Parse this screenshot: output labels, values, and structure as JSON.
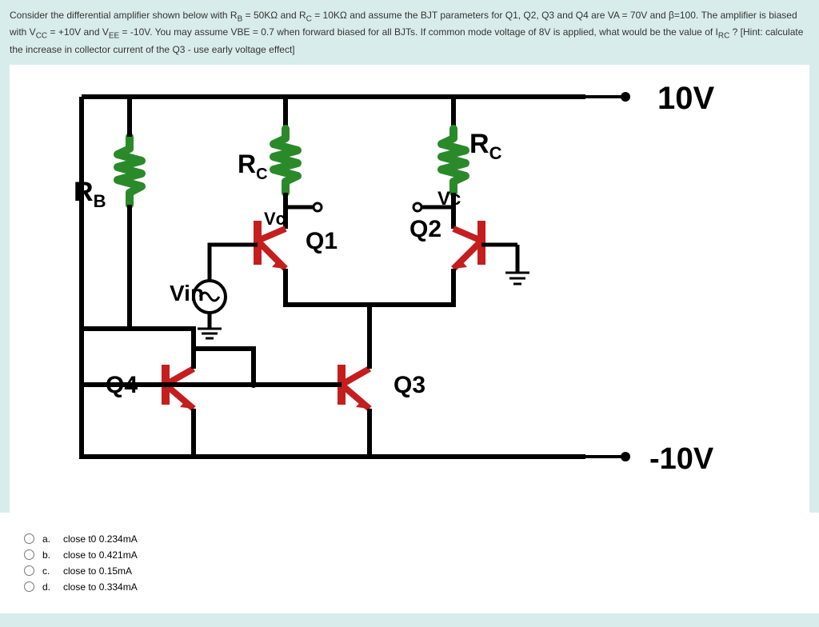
{
  "question": {
    "text_line1": "Consider the differential amplifier shown below with R",
    "rb_sub": "B",
    "text_eq1": " = 50KΩ and R",
    "rc_sub": "C",
    "text_eq2": " = 10KΩ and assume the BJT parameters for Q1, Q2, Q3 and Q4 are VA = 70V and β=100.  The amplifier is biased with V",
    "vcc_sub": "CC",
    "text_eq3": " = +10V and V",
    "vee_sub": "EE",
    "text_eq4": " = -10V.  You may assume VBE = 0.7 when forward biased for all BJTs. If common mode voltage of 8V is applied, what would be the value of I",
    "irc_sub": "RC",
    "text_eq5": " ? [Hint: calculate the increase in collector current of the Q3 - use early voltage effect]"
  },
  "labels": {
    "vcc": "10V",
    "vee": "-10V",
    "rb": "R",
    "rb_sub": "B",
    "rc_left": "R",
    "rc_left_sub": "C",
    "rc_right": "R",
    "rc_right_sub": "C",
    "vc_left": "Vc",
    "vc_right": "Vc",
    "q1": "Q1",
    "q2": "Q2",
    "q3": "Q3",
    "q4": "Q4",
    "vin": "Vin"
  },
  "options": {
    "a": {
      "letter": "a.",
      "text": "close t0 0.234mA"
    },
    "b": {
      "letter": "b.",
      "text": "close to 0.421mA"
    },
    "c": {
      "letter": "c.",
      "text": "close to 0.15mA"
    },
    "d": {
      "letter": "d.",
      "text": "close to 0.334mA"
    }
  }
}
